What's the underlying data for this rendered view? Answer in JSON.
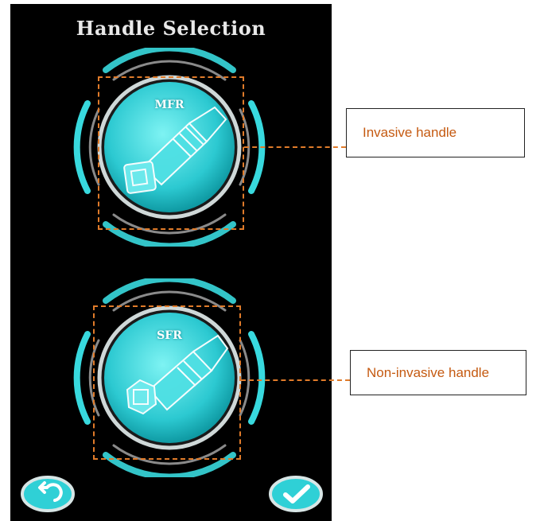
{
  "screen": {
    "title": "Handle Selection",
    "background": "#000000",
    "accent": "#38d9de"
  },
  "handles": [
    {
      "label": "MFR",
      "annotation": "Invasive handle"
    },
    {
      "label": "SFR",
      "annotation": "Non-invasive handle"
    }
  ],
  "footer": {
    "back_icon": "back-arrow-icon",
    "confirm_icon": "checkmark-icon"
  },
  "annotation_color": "#c55a11"
}
